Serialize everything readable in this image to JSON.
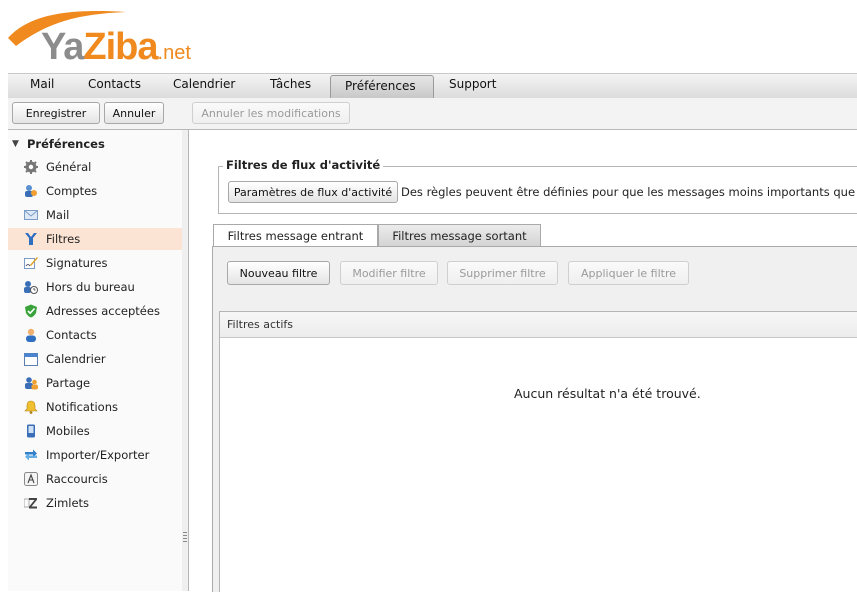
{
  "brand": {
    "logo_ya": "Ya",
    "logo_ziba": "Ziba",
    "logo_net": ".net",
    "accent_color": "#f08a1e"
  },
  "nav_tabs": [
    {
      "label": "Mail"
    },
    {
      "label": "Contacts"
    },
    {
      "label": "Calendrier"
    },
    {
      "label": "Tâches"
    },
    {
      "label": "Préférences",
      "active": true
    },
    {
      "label": "Support"
    }
  ],
  "toolbar": {
    "save_label": "Enregistrer",
    "cancel_label": "Annuler",
    "undo_changes_label": "Annuler les modifications"
  },
  "sidebar": {
    "header": "Préférences",
    "items": [
      {
        "label": "Général",
        "icon": "gear-icon"
      },
      {
        "label": "Comptes",
        "icon": "accounts-icon"
      },
      {
        "label": "Mail",
        "icon": "envelope-icon"
      },
      {
        "label": "Filtres",
        "icon": "filter-icon",
        "selected": true
      },
      {
        "label": "Signatures",
        "icon": "signature-icon"
      },
      {
        "label": "Hors du bureau",
        "icon": "out-of-office-icon"
      },
      {
        "label": "Adresses acceptées",
        "icon": "shield-check-icon"
      },
      {
        "label": "Contacts",
        "icon": "person-icon"
      },
      {
        "label": "Calendrier",
        "icon": "calendar-icon"
      },
      {
        "label": "Partage",
        "icon": "share-icon"
      },
      {
        "label": "Notifications",
        "icon": "bell-icon"
      },
      {
        "label": "Mobiles",
        "icon": "mobile-icon"
      },
      {
        "label": "Importer/Exporter",
        "icon": "import-export-icon"
      },
      {
        "label": "Raccourcis",
        "icon": "shortcut-icon"
      },
      {
        "label": "Zimlets",
        "icon": "zimlet-icon"
      }
    ]
  },
  "activity_filters": {
    "legend": "Filtres de flux d'activité",
    "settings_button": "Paramètres de flux d'activité",
    "description": "Des règles peuvent être définies pour que les messages moins importants que vou"
  },
  "filter_tabs": {
    "incoming": "Filtres message entrant",
    "outgoing": "Filtres message sortant"
  },
  "filter_actions": {
    "new": "Nouveau filtre",
    "edit": "Modifier filtre",
    "delete": "Supprimer filtre",
    "apply": "Appliquer le filtre"
  },
  "active_filters": {
    "header": "Filtres actifs",
    "empty_message": "Aucun résultat n'a été trouvé."
  }
}
